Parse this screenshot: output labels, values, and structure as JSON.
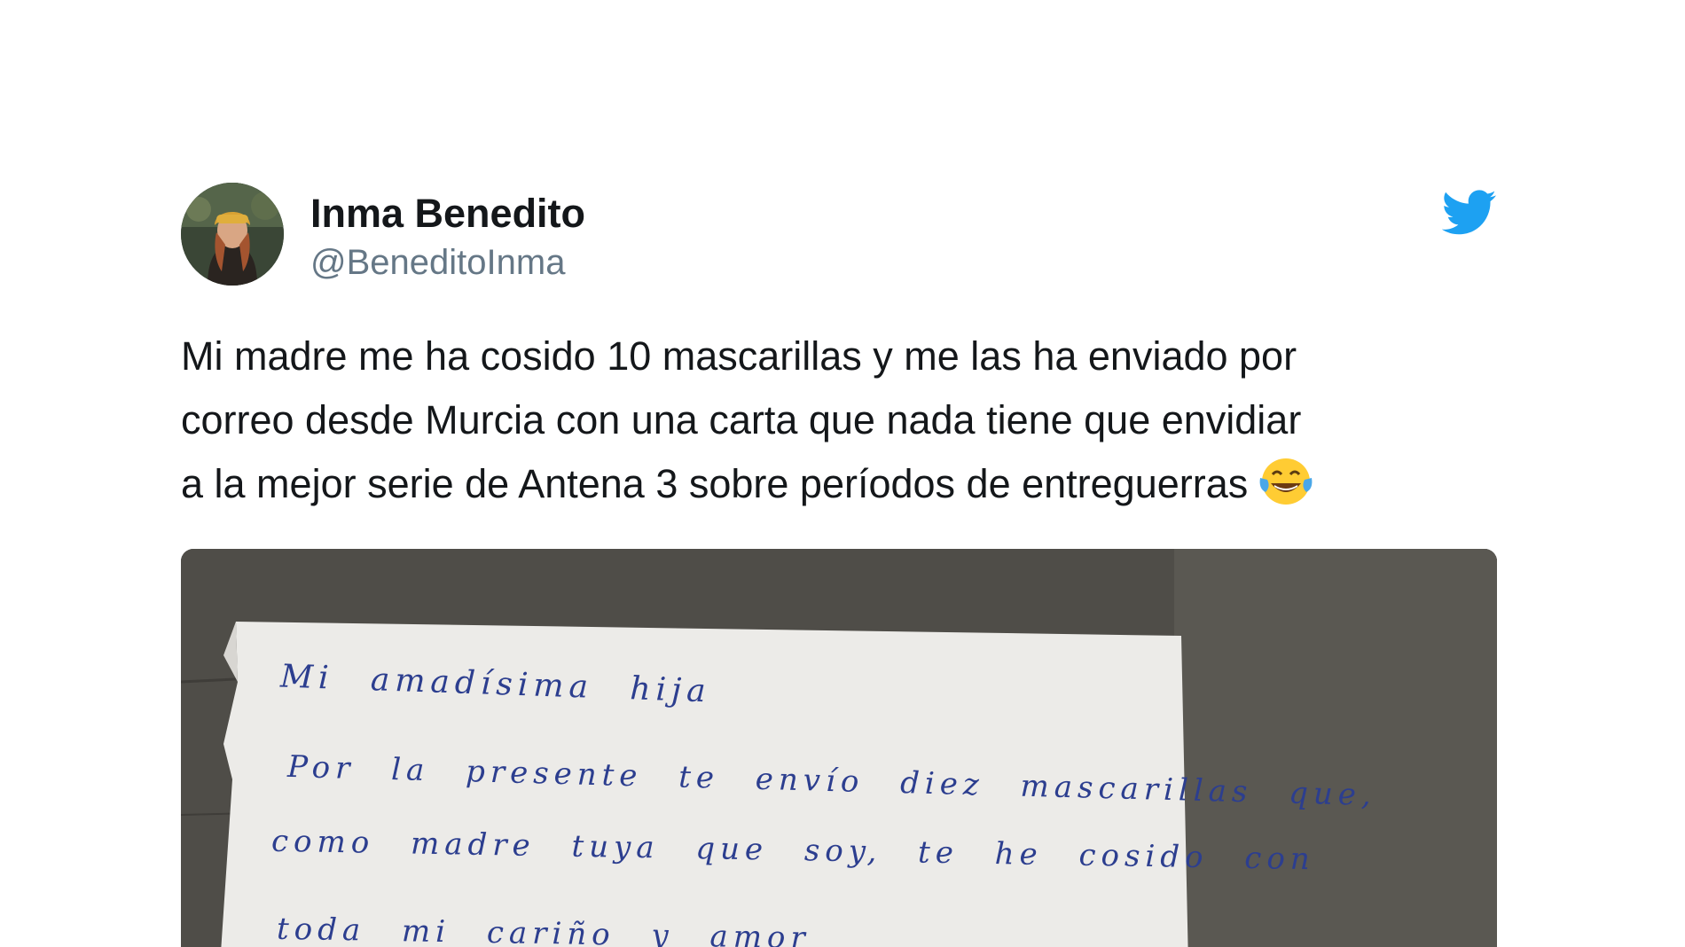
{
  "tweet": {
    "author_name": "Inma Benedito",
    "author_handle": "@BeneditoInma",
    "text_lines": [
      "Mi madre me ha cosido 10 mascarillas y me las ha enviado por",
      "correo desde Murcia con una carta que nada tiene que envidiar",
      "a la mejor serie de Antena 3 sobre períodos de entreguerras"
    ],
    "emoji": "face-with-tears-of-joy",
    "brand_icon": "twitter-bird-icon",
    "brand_color": "#1da1f2"
  },
  "media": {
    "letter_lines": [
      "Mi amadísima hija",
      "Por la presente te envío diez mascarillas que,",
      "como madre tuya que soy, te he cosido con",
      "toda mi cariño y amor"
    ],
    "ink_color": "#2c3e8f"
  }
}
